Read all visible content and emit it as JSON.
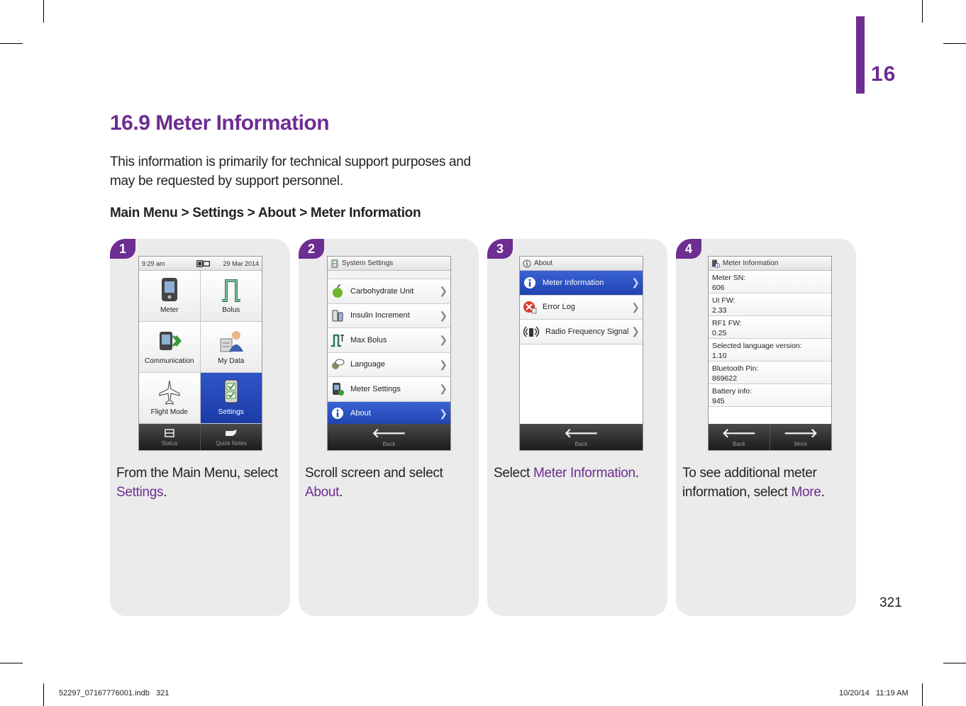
{
  "chapter": {
    "number": "16",
    "accent_color": "#6d2d91"
  },
  "section": {
    "title": "16.9 Meter Information",
    "intro": "This information is primarily for technical support purposes and may be requested by support personnel.",
    "nav_path": "Main Menu > Settings > About > Meter Information"
  },
  "steps": [
    {
      "badge": "1",
      "caption_pre": "From the Main Menu, select ",
      "caption_link": "Settings",
      "caption_post": ".",
      "screen": {
        "time": "9:29 am",
        "date": "29 Mar 2014",
        "tiles": [
          {
            "label": "Meter",
            "icon": "meter-icon"
          },
          {
            "label": "Bolus",
            "icon": "bolus-icon"
          },
          {
            "label": "Communication",
            "icon": "communication-icon"
          },
          {
            "label": "My Data",
            "icon": "my-data-icon"
          },
          {
            "label": "Flight Mode",
            "icon": "airplane-icon"
          },
          {
            "label": "Settings",
            "icon": "settings-icon",
            "selected": true
          }
        ],
        "bottom": [
          {
            "label": "Status"
          },
          {
            "label": "Quick Notes"
          }
        ]
      }
    },
    {
      "badge": "2",
      "caption_pre": "Scroll screen and select ",
      "caption_link": "About",
      "caption_post": ".",
      "screen": {
        "title": "System Settings",
        "rows": [
          {
            "label": "Carbohydrate Unit",
            "icon": "apple-icon"
          },
          {
            "label": "Insulin Increment",
            "icon": "insulin-icon"
          },
          {
            "label": "Max Bolus",
            "icon": "max-bolus-icon"
          },
          {
            "label": "Language",
            "icon": "language-icon"
          },
          {
            "label": "Meter Settings",
            "icon": "meter-settings-icon"
          },
          {
            "label": "About",
            "icon": "info-icon",
            "selected": true
          }
        ],
        "bottom": [
          {
            "label": "Back"
          }
        ]
      }
    },
    {
      "badge": "3",
      "caption_pre": "Select ",
      "caption_link": "Meter Information",
      "caption_post": ".",
      "screen": {
        "title": "About",
        "rows": [
          {
            "label": "Meter Information",
            "icon": "info-icon",
            "selected": true
          },
          {
            "label": "Error Log",
            "icon": "error-log-icon"
          },
          {
            "label": "Radio Frequency Signal",
            "icon": "radio-signal-icon"
          }
        ],
        "bottom": [
          {
            "label": "Back"
          }
        ]
      }
    },
    {
      "badge": "4",
      "caption_pre": "To see additional meter information, select ",
      "caption_link": "More",
      "caption_post": ".",
      "screen": {
        "title": "Meter Information",
        "fields": [
          {
            "label": "Meter SN:",
            "value": "606"
          },
          {
            "label": "UI FW:",
            "value": "2.33"
          },
          {
            "label": "RF1 FW:",
            "value": "0.25"
          },
          {
            "label": "Selected language version:",
            "value": "1.10"
          },
          {
            "label": "Bluetooth Pin:",
            "value": "869622"
          },
          {
            "label": "Battery info:",
            "value": "945"
          }
        ],
        "bottom": [
          {
            "label": "Back"
          },
          {
            "label": "More"
          }
        ]
      }
    }
  ],
  "page_number": "321",
  "footer": {
    "file": "52297_07167776001.indb   321",
    "timestamp": "10/20/14   11:19 AM"
  }
}
